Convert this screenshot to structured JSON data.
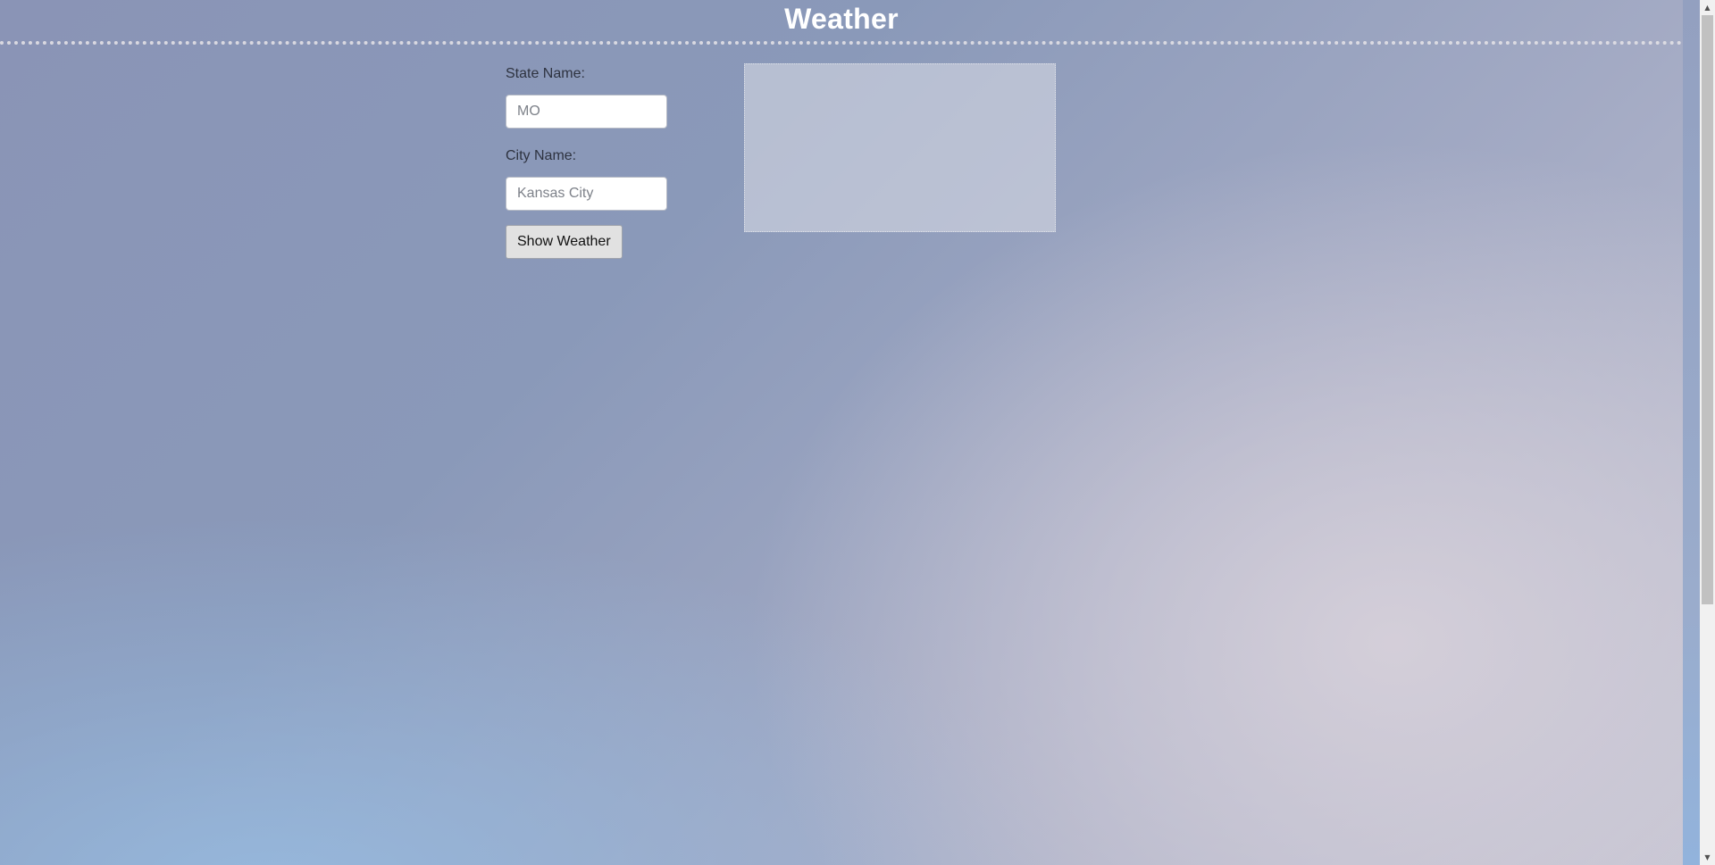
{
  "header": {
    "title": "Weather"
  },
  "form": {
    "state_label": "State Name:",
    "state_placeholder": "MO",
    "state_value": "",
    "city_label": "City Name:",
    "city_placeholder": "Kansas City",
    "city_value": "",
    "submit_label": "Show Weather"
  },
  "scrollbar": {
    "up_icon": "arrow-up-icon",
    "down_icon": "arrow-down-icon",
    "up_glyph": "▲",
    "down_glyph": "▼"
  },
  "colors": {
    "title": "#ffffff",
    "button_bg": "#e1e1e1",
    "panel_bg": "#d4d7e2"
  }
}
